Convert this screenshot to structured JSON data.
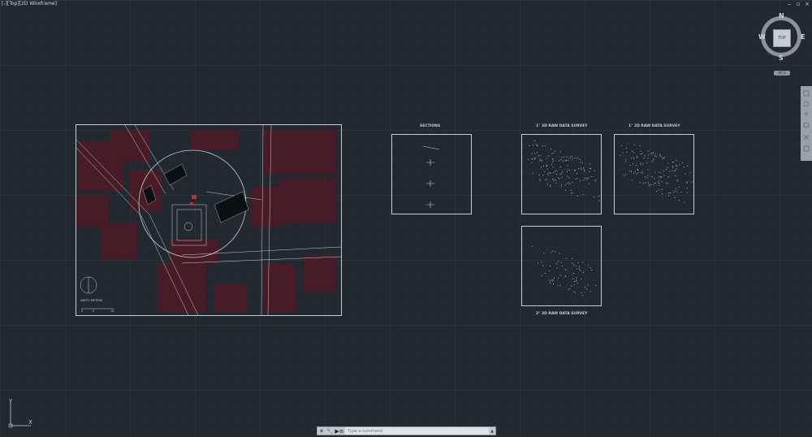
{
  "viewport": {
    "label": "[-][Top][2D Wireframe]"
  },
  "window_controls": {
    "minimize": "‒",
    "restore": "▫",
    "close": "×"
  },
  "viewcube": {
    "north": "N",
    "south": "S",
    "east": "E",
    "west": "W",
    "face": "TOP",
    "wcs": "WCS"
  },
  "sheets": {
    "sections": "SECTIONS",
    "survey_1": "1° 3D RAW DATA SURVEY",
    "survey_2": "1° 2D RAW DATA SURVEY",
    "survey_3": "2° 3D RAW DATA SURVEY"
  },
  "site_plan": {
    "units": "UNITS: METERS",
    "scale": [
      "0",
      "5",
      "10"
    ]
  },
  "ucs": {
    "x": "X",
    "y": "Y"
  },
  "command_line": {
    "placeholder": "Type a command",
    "close": "✕",
    "customize": "🔧",
    "history": "▶≡"
  },
  "colors": {
    "background": "#212830",
    "buildings": "#5a1f2a",
    "lines": "#c9cdd2"
  }
}
